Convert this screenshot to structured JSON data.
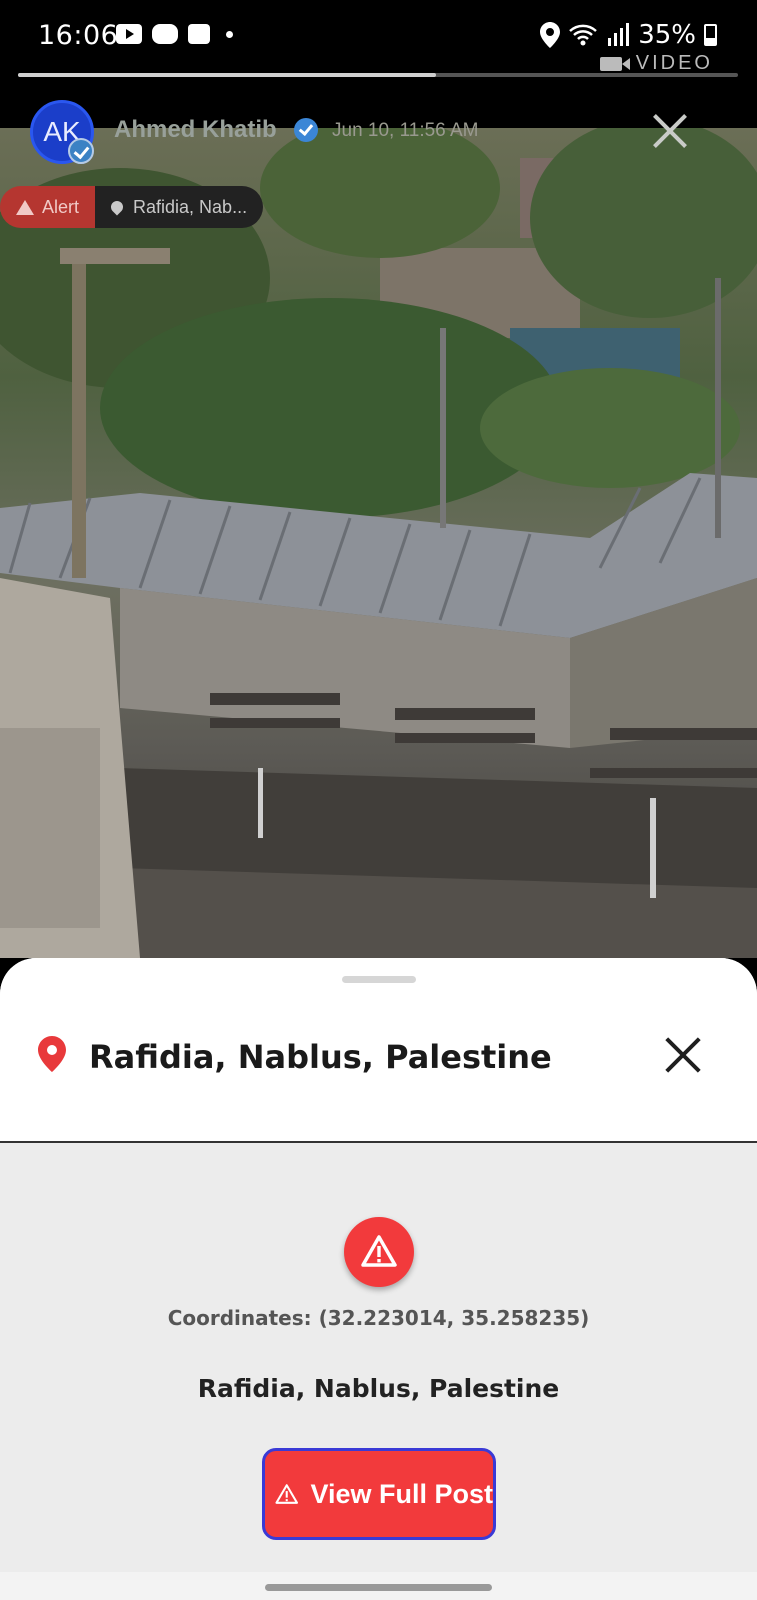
{
  "status_bar": {
    "time": "16:06",
    "battery": "35%",
    "icons": [
      "youtube-icon",
      "discord-icon",
      "gallery-icon",
      "dot-icon",
      "location-icon",
      "wifi-icon",
      "signal-icon",
      "battery-icon"
    ]
  },
  "media": {
    "type_label": "VIDEO",
    "progress": 0.58
  },
  "post": {
    "avatar_initials": "AK",
    "author": "Ahmed Khatib",
    "date": "Jun 10, 11:56 AM",
    "alert_chip": "Alert",
    "location_chip": "Rafidia, Nab..."
  },
  "sheet": {
    "title": "Rafidia, Nablus, Palestine",
    "coordinates": "Coordinates: (32.223014, 35.258235)",
    "place_name": "Rafidia, Nablus, Palestine",
    "button_label": "View Full Post"
  },
  "colors": {
    "accent_red": "#f23a3c",
    "button_border": "#3a3ad6",
    "avatar_blue": "#1b3ec9"
  }
}
